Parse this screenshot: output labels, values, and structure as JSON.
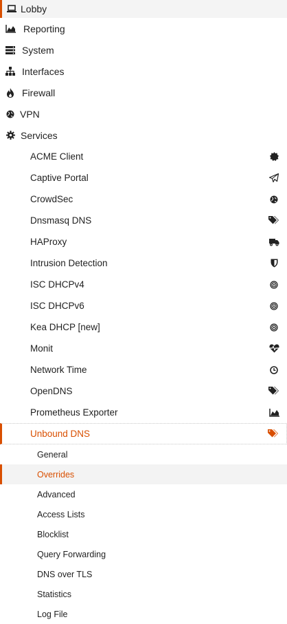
{
  "colors": {
    "accent": "#d94f00",
    "text": "#1f1f1f",
    "active_bg": "#f4f4f4"
  },
  "menu": [
    {
      "label": "Lobby",
      "icon": "laptop-icon"
    },
    {
      "label": "Reporting",
      "icon": "area-chart-icon"
    },
    {
      "label": "System",
      "icon": "server-icon"
    },
    {
      "label": "Interfaces",
      "icon": "sitemap-icon"
    },
    {
      "label": "Firewall",
      "icon": "fire-icon"
    },
    {
      "label": "VPN",
      "icon": "globe-icon"
    },
    {
      "label": "Services",
      "icon": "gear-icon"
    }
  ],
  "services": [
    {
      "label": "ACME Client",
      "icon": "certificate-icon"
    },
    {
      "label": "Captive Portal",
      "icon": "paper-plane-icon"
    },
    {
      "label": "CrowdSec",
      "icon": "globe-icon"
    },
    {
      "label": "Dnsmasq DNS",
      "icon": "tags-icon"
    },
    {
      "label": "HAProxy",
      "icon": "truck-icon"
    },
    {
      "label": "Intrusion Detection",
      "icon": "shield-icon"
    },
    {
      "label": "ISC DHCPv4",
      "icon": "bullseye-icon"
    },
    {
      "label": "ISC DHCPv6",
      "icon": "bullseye-icon"
    },
    {
      "label": "Kea DHCP [new]",
      "icon": "bullseye-icon"
    },
    {
      "label": "Monit",
      "icon": "heartbeat-icon"
    },
    {
      "label": "Network Time",
      "icon": "clock-icon"
    },
    {
      "label": "OpenDNS",
      "icon": "tags-icon"
    },
    {
      "label": "Prometheus Exporter",
      "icon": "area-chart-icon"
    },
    {
      "label": "Unbound DNS",
      "icon": "tags-icon",
      "active": true
    }
  ],
  "unbound": [
    {
      "label": "General"
    },
    {
      "label": "Overrides",
      "active": true
    },
    {
      "label": "Advanced"
    },
    {
      "label": "Access Lists"
    },
    {
      "label": "Blocklist"
    },
    {
      "label": "Query Forwarding"
    },
    {
      "label": "DNS over TLS"
    },
    {
      "label": "Statistics"
    },
    {
      "label": "Log File"
    }
  ]
}
